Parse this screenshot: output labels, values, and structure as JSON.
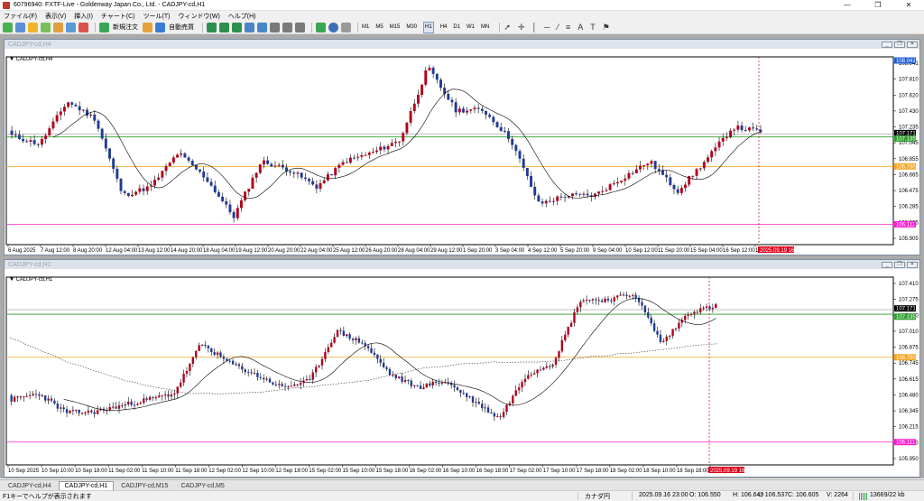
{
  "window": {
    "title": "60796940: FXTF-Live - Goldenway Japan Co., Ltd. - CADJPY-cd,H1",
    "min_icon": "—",
    "max_icon": "❐",
    "close_icon": "✕"
  },
  "menu": [
    "ファイル(F)",
    "表示(V)",
    "挿入(I)",
    "チャート(C)",
    "ツール(T)",
    "ウィンドウ(W)",
    "ヘルプ(H)"
  ],
  "toolbar": {
    "new_order_label": "新規注文",
    "auto_trade_label": "自動売買",
    "timeframes": [
      "M1",
      "M5",
      "M15",
      "M30",
      "H1",
      "H4",
      "D1",
      "W1",
      "MN"
    ],
    "active_timeframe": "H1",
    "tools": [
      "✛",
      "│",
      "─",
      "⁄",
      "≡",
      "A",
      "T",
      "⚑"
    ]
  },
  "charts": [
    {
      "window_title": "CADJPY-cd,H4",
      "label": "CADJPY-cd,H4",
      "price_ticks": [
        "108.041",
        "107.810",
        "107.620",
        "107.430",
        "107.235",
        "107.045",
        "106.855",
        "106.665",
        "106.475",
        "106.285",
        "106.095",
        "105.905"
      ],
      "price_min": 105.905,
      "price_max": 108.041,
      "time_labels": [
        "6 Aug 2025",
        "7 Aug 12:00",
        "8 Aug 20:00",
        "12 Aug 04:00",
        "13 Aug 12:00",
        "14 Aug 20:00",
        "18 Aug 04:00",
        "19 Aug 12:00",
        "20 Aug 20:00",
        "22 Aug 04:00",
        "25 Aug 12:00",
        "26 Aug 20:00",
        "28 Aug 04:00",
        "29 Aug 12:00",
        "1 Sep 20:00",
        "3 Sep 04:00",
        "4 Sep 12:00",
        "5 Sep 20:00",
        "9 Sep 04:00",
        "10 Sep 12:00",
        "11 Sep 20:00",
        "15 Sep 04:00",
        "16 Sep 12:00",
        "17 Sep 20:00"
      ],
      "current_time": "2025.09.19 16:00",
      "level_labels": {
        "top": "108.041",
        "ask": "107.171",
        "bid": "107.135",
        "orange": "106.790",
        "magenta": "106.111"
      },
      "levels": {
        "ask": 107.171,
        "green": 107.135,
        "orange": 106.79,
        "magenta": 106.111
      },
      "close_price": 107.22
    },
    {
      "window_title": "CADJPY-cd,H1",
      "label": "CADJPY-cd,H1",
      "price_ticks": [
        "107.410",
        "107.275",
        "107.140",
        "107.010",
        "106.875",
        "106.745",
        "106.615",
        "106.480",
        "106.345",
        "106.215",
        "106.080",
        "105.950"
      ],
      "price_min": 105.95,
      "price_max": 107.41,
      "time_labels": [
        "10 Sep 2025",
        "10 Sep 10:00",
        "10 Sep 18:00",
        "11 Sep 02:00",
        "11 Sep 10:00",
        "11 Sep 18:00",
        "12 Sep 02:00",
        "12 Sep 10:00",
        "12 Sep 18:00",
        "15 Sep 02:00",
        "15 Sep 10:00",
        "15 Sep 18:00",
        "16 Sep 02:00",
        "16 Sep 10:00",
        "16 Sep 18:00",
        "17 Sep 02:00",
        "17 Sep 10:00",
        "17 Sep 18:00",
        "18 Sep 02:00",
        "18 Sep 10:00",
        "18 Sep 18:00",
        "19 Sep 02:00"
      ],
      "current_time": "2025.09.19 16:00",
      "level_labels": {
        "ask": "107.171",
        "bid": "107.135",
        "orange": "106.790",
        "magenta": "106.111"
      },
      "levels": {
        "ask": 107.171,
        "green": 107.135,
        "orange": 106.79,
        "magenta": 106.111
      },
      "close_price": 107.13
    }
  ],
  "tabs": [
    "CADJPY-cd,H4",
    "CADJPY-cd,H1",
    "CADJPY-cd,M15",
    "CADJPY-cd,M5"
  ],
  "active_tab": 1,
  "status": {
    "help": "F1キーでヘルプが表示されます",
    "profile": "カナダ円",
    "datetime": "2025.09.16 23:00",
    "open": "O: 106.550",
    "high": "H: 106.649",
    "low": "L: 106.537",
    "close": "C: 106.605",
    "volume": "V: 2264",
    "traffic": "13669/22 kb"
  },
  "colors": {
    "bull": "#b3001b",
    "bear": "#1f3b99",
    "green_line": "#2e9e2e",
    "orange_line": "#f5a623",
    "magenta_line": "#ff1fd3",
    "ask_line": "#9a9a9a",
    "time_marker": "#e0001a",
    "ma": "#000000"
  }
}
